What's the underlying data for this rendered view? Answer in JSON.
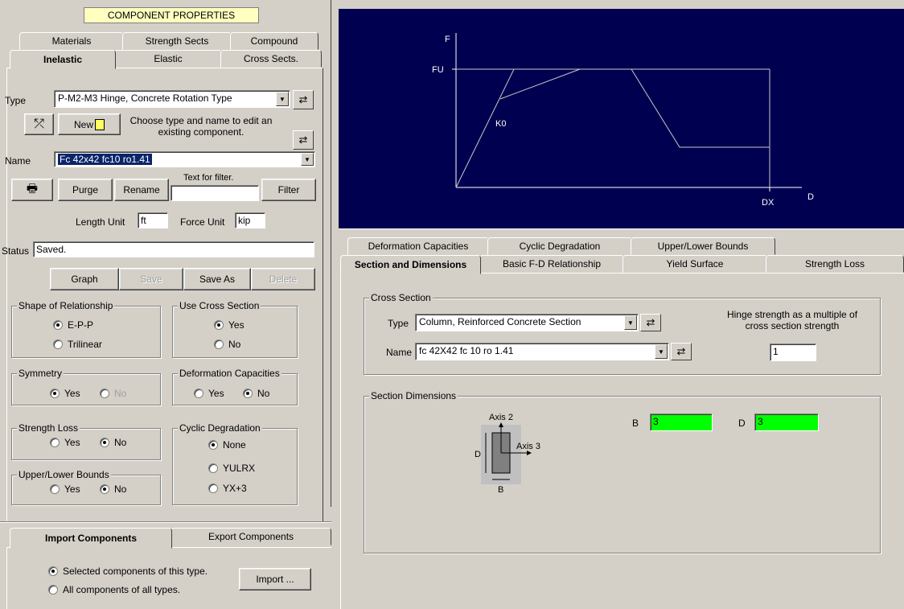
{
  "left": {
    "title": "COMPONENT PROPERTIES",
    "tabs_row1": [
      "Materials",
      "Strength Sects",
      "Compound"
    ],
    "tabs_row2": [
      "Inelastic",
      "Elastic",
      "Cross Sects."
    ],
    "type_label": "Type",
    "type_value": "P-M2-M3 Hinge, Concrete Rotation Type",
    "new_label": "New",
    "hint": "Choose type and name to edit an existing component.",
    "name_label": "Name",
    "name_value": "Fc 42x42 fc10 ro1.41",
    "purge": "Purge",
    "rename": "Rename",
    "filter_hint": "Text for filter.",
    "filter_value": "",
    "filter": "Filter",
    "length_unit_label": "Length Unit",
    "length_unit": "ft",
    "force_unit_label": "Force Unit",
    "force_unit": "kip",
    "status_label": "Status",
    "status_value": "Saved.",
    "graph": "Graph",
    "save": "Save",
    "save_as": "Save As",
    "delete": "Delete",
    "shape_group": "Shape of Relationship",
    "shape_opts": [
      "E-P-P",
      "Trilinear"
    ],
    "use_cs_group": "Use Cross Section",
    "use_cs_opts": [
      "Yes",
      "No"
    ],
    "symmetry_group": "Symmetry",
    "symmetry_opts": [
      "Yes",
      "No"
    ],
    "defcap_group": "Deformation Capacities",
    "defcap_opts": [
      "Yes",
      "No"
    ],
    "strloss_group": "Strength Loss",
    "strloss_opts": [
      "Yes",
      "No"
    ],
    "cyclic_group": "Cyclic Degradation",
    "cyclic_opts": [
      "None",
      "YULRX",
      "YX+3"
    ],
    "ulb_group": "Upper/Lower Bounds",
    "ulb_opts": [
      "Yes",
      "No"
    ]
  },
  "import": {
    "tabs": [
      "Import Components",
      "Export Components"
    ],
    "opts": [
      "Selected components of this type.",
      "All components of all types."
    ],
    "button": "Import ..."
  },
  "graph": {
    "f_label": "F",
    "fu_label": "FU",
    "k0_label": "K0",
    "dx_label": "DX",
    "d_label": "D",
    "bg": "#000050"
  },
  "right": {
    "tabs_row1": [
      "Deformation Capacities",
      "Cyclic Degradation",
      "Upper/Lower Bounds"
    ],
    "tabs_row2": [
      "Section and Dimensions",
      "Basic F-D Relationship",
      "Yield Surface",
      "Strength Loss"
    ],
    "cs_group": "Cross Section",
    "cs_type_label": "Type",
    "cs_type_value": "Column, Reinforced Concrete Section",
    "cs_name_label": "Name",
    "cs_name_value": "fc 42X42 fc 10 ro 1.41",
    "hinge_text": "Hinge strength as a multiple of cross section strength",
    "hinge_value": "1",
    "dims_group": "Section Dimensions",
    "axis2": "Axis 2",
    "axis3": "Axis 3",
    "d_small": "D",
    "b_small": "B",
    "b_label": "B",
    "b_value": "3",
    "d_label": "D",
    "d_value": "3",
    "green": "#00ff00"
  }
}
